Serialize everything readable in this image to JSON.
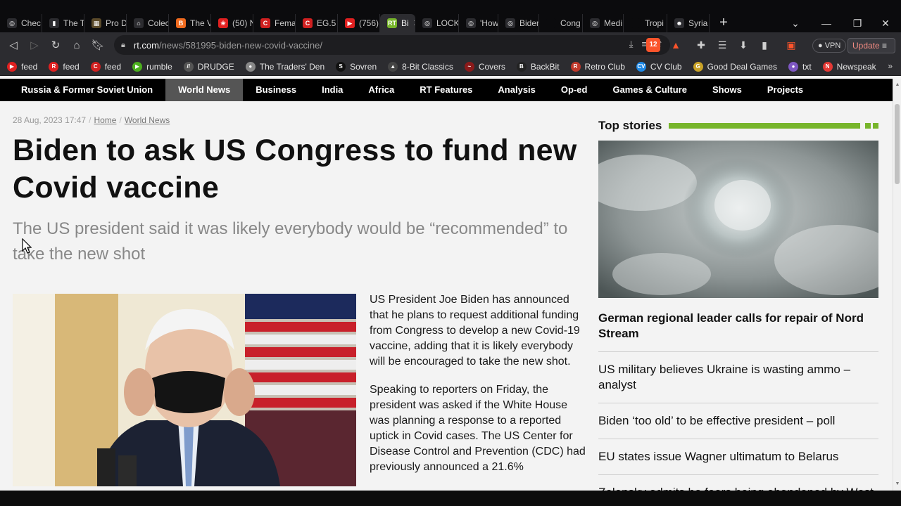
{
  "tabs": [
    {
      "label": "Chec",
      "icon": "globe-icon",
      "color": "#2c2c30"
    },
    {
      "label": "The T",
      "icon": "doc-icon",
      "color": "#2c2c30"
    },
    {
      "label": "Pro D",
      "icon": "image-icon",
      "color": "#5b4a2a"
    },
    {
      "label": "Colec",
      "icon": "bank-icon",
      "color": "#2c2c30"
    },
    {
      "label": "The V",
      "icon": "blogger-icon",
      "color": "#f06a1e"
    },
    {
      "label": "(50) N",
      "icon": "rumble-icon",
      "color": "#e02020"
    },
    {
      "label": "Fema",
      "icon": "c-icon",
      "color": "#d02020"
    },
    {
      "label": "EG.5",
      "icon": "c-icon",
      "color": "#d02020"
    },
    {
      "label": "(756)",
      "icon": "youtube-icon",
      "color": "#e02020"
    },
    {
      "label": "Bi",
      "icon": "rt-icon",
      "color": "#77b52b"
    },
    {
      "label": "LOCK",
      "icon": "globe-icon",
      "color": "#2c2c30"
    },
    {
      "label": "'How",
      "icon": "globe-icon",
      "color": "#2c2c30"
    },
    {
      "label": "Biden",
      "icon": "globe-icon",
      "color": "#2c2c30"
    },
    {
      "label": "Cong",
      "icon": "blank-icon",
      "color": "#0b0b0d"
    },
    {
      "label": "Medi",
      "icon": "globe-icon",
      "color": "#2c2c30"
    },
    {
      "label": "Tropi",
      "icon": "blank-icon",
      "color": "#0b0b0d"
    },
    {
      "label": "Syria",
      "icon": "user-icon",
      "color": "#2c2c30"
    }
  ],
  "address": {
    "host": "rt.com",
    "path": "/news/581995-biden-new-covid-vaccine/"
  },
  "toolbar": {
    "vpn_label": "VPN",
    "update_label": "Update",
    "brave_badge": "12"
  },
  "bookmarks": [
    {
      "label": "feed",
      "color": "#e02020",
      "glyph": "▶"
    },
    {
      "label": "feed",
      "color": "#e02020",
      "glyph": "R"
    },
    {
      "label": "feed",
      "color": "#d02020",
      "glyph": "C"
    },
    {
      "label": "rumble",
      "color": "#4caf1e",
      "glyph": "▶"
    },
    {
      "label": "DRUDGE",
      "color": "#555555",
      "glyph": "//"
    },
    {
      "label": "The Traders' Den",
      "color": "#888888",
      "glyph": "●"
    },
    {
      "label": "Sovren",
      "color": "#111111",
      "glyph": "S"
    },
    {
      "label": "8-Bit Classics",
      "color": "#444444",
      "glyph": "▲"
    },
    {
      "label": "Covers",
      "color": "#8b1a1a",
      "glyph": "~"
    },
    {
      "label": "BackBit",
      "color": "#222222",
      "glyph": "B"
    },
    {
      "label": "Retro Club",
      "color": "#c0392b",
      "glyph": "R"
    },
    {
      "label": "CV Club",
      "color": "#1e88e5",
      "glyph": "CV"
    },
    {
      "label": "Good Deal Games",
      "color": "#c9a227",
      "glyph": "G"
    },
    {
      "label": "txt",
      "color": "#7e57c2",
      "glyph": "●"
    },
    {
      "label": "Newspeak",
      "color": "#e53935",
      "glyph": "N"
    }
  ],
  "site_nav": [
    {
      "label": "Russia & Former Soviet Union",
      "active": false
    },
    {
      "label": "World News",
      "active": true
    },
    {
      "label": "Business",
      "active": false
    },
    {
      "label": "India",
      "active": false
    },
    {
      "label": "Africa",
      "active": false
    },
    {
      "label": "RT Features",
      "active": false
    },
    {
      "label": "Analysis",
      "active": false
    },
    {
      "label": "Op-ed",
      "active": false
    },
    {
      "label": "Games & Culture",
      "active": false
    },
    {
      "label": "Shows",
      "active": false
    },
    {
      "label": "Projects",
      "active": false
    }
  ],
  "article": {
    "date": "28 Aug, 2023 17:47",
    "breadcrumb_home": "Home",
    "breadcrumb_section": "World News",
    "title": "Biden to ask US Congress to fund new Covid vaccine",
    "summary": "The US president said it was likely everybody would be “recommended” to take the new shot",
    "paragraphs": [
      "US President Joe Biden has announced that he plans to request additional funding from Congress to develop a new Covid-19 vaccine, adding that it is likely everybody will be encouraged to take the new shot.",
      "Speaking to reporters on Friday, the president was asked if the White House was planning a response to a reported uptick in Covid cases. The US Center for Disease Control and Prevention (CDC) had previously announced a 21.6%"
    ]
  },
  "top_stories": {
    "heading": "Top stories",
    "lead": "German regional leader calls for repair of Nord Stream",
    "items": [
      "US military believes Ukraine is wasting ammo – analyst",
      "Biden ‘too old’ to be effective president – poll",
      "EU states issue Wagner ultimatum to Belarus",
      "Zelensky admits he fears being abandoned by West"
    ]
  },
  "colors": {
    "accent_green": "#77b52b",
    "nav_bg": "#000000",
    "nav_active": "#555555"
  }
}
